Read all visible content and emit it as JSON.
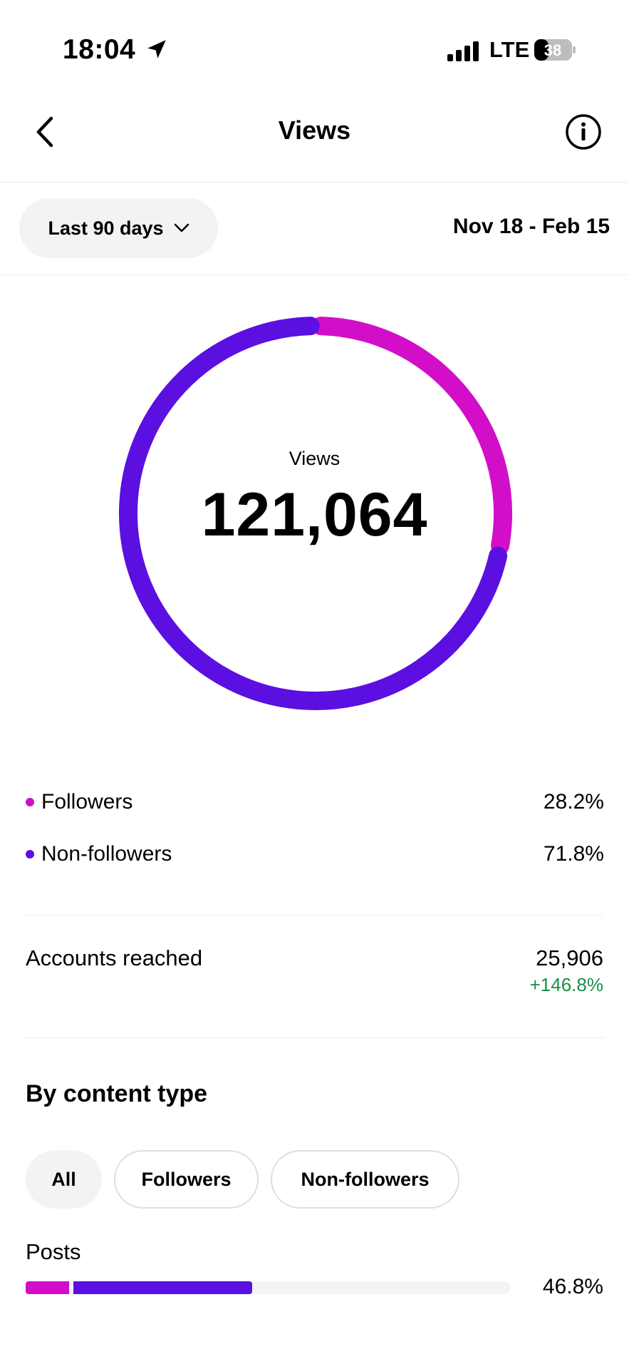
{
  "status_bar": {
    "time": "18:04",
    "network": "LTE",
    "battery": "38"
  },
  "header": {
    "title": "Views"
  },
  "range": {
    "label": "Last 90 days",
    "dates": "Nov 18 - Feb 15"
  },
  "summary": {
    "label": "Views",
    "value": "121,064"
  },
  "breakdown": [
    {
      "label": "Followers",
      "value": "28.2%",
      "fraction": 0.282,
      "color": "#d20ec8"
    },
    {
      "label": "Non-followers",
      "value": "71.8%",
      "fraction": 0.718,
      "color": "#5b0fe0"
    }
  ],
  "accounts_reached": {
    "label": "Accounts reached",
    "value": "25,906",
    "change": "+146.8%"
  },
  "content_type": {
    "title": "By content type",
    "chips": [
      "All",
      "Followers",
      "Non-followers"
    ],
    "active_chip": "All",
    "rows": [
      {
        "label": "Posts",
        "value": "46.8%",
        "fraction": 0.468,
        "followers_share": 0.2
      }
    ]
  },
  "colors": {
    "followers": "#d20ec8",
    "non_followers": "#5b0fe0",
    "positive": "#1a8f47"
  }
}
